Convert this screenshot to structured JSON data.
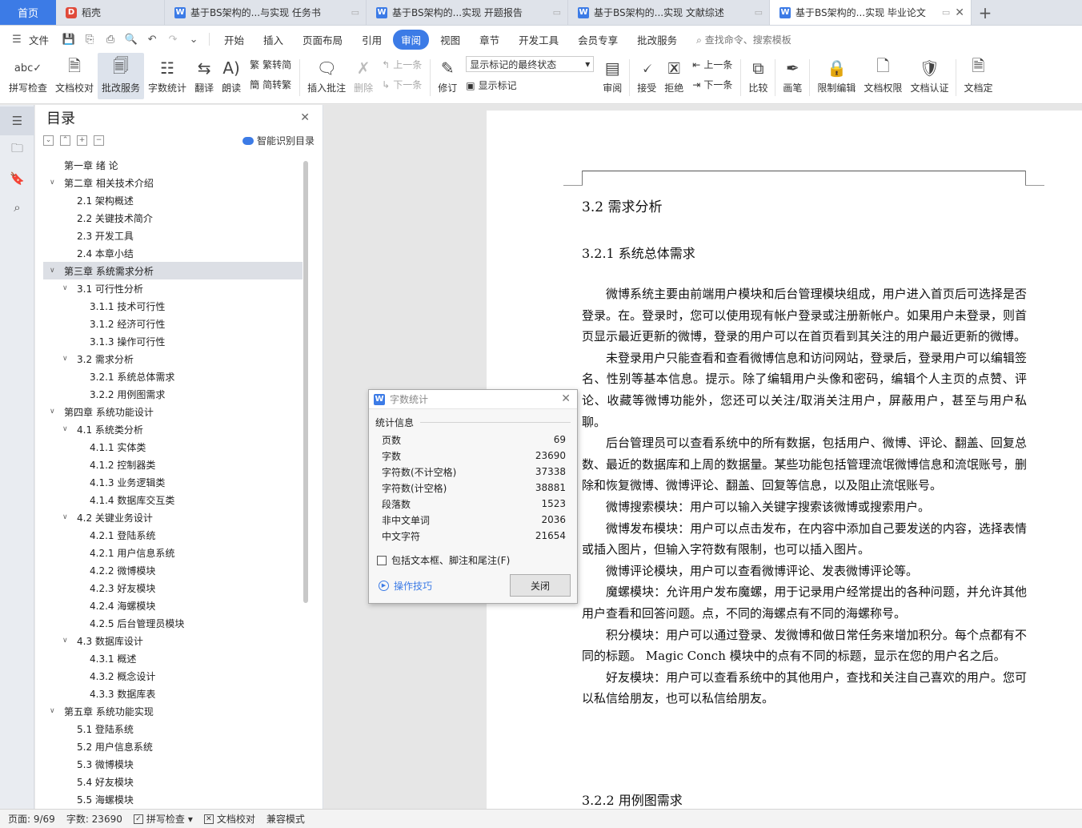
{
  "tabs": {
    "home": "首页",
    "items": [
      {
        "label": "稻壳",
        "icon": "daoke-icon"
      },
      {
        "label": "基于BS架构的...与实现 任务书",
        "icon": "wps-writer-icon"
      },
      {
        "label": "基于BS架构的...实现 开题报告",
        "icon": "wps-writer-icon"
      },
      {
        "label": "基于BS架构的...实现 文献综述",
        "icon": "wps-writer-icon"
      },
      {
        "label": "基于BS架构的...实现 毕业论文",
        "icon": "wps-writer-icon"
      }
    ],
    "add": "+"
  },
  "menubar": {
    "file": "文件",
    "items": [
      "开始",
      "插入",
      "页面布局",
      "引用",
      "审阅",
      "视图",
      "章节",
      "开发工具",
      "会员专享",
      "批改服务"
    ],
    "active": "审阅",
    "search_placeholder": "查找命令、搜索模板"
  },
  "ribbon": {
    "spell_check": "拼写检查",
    "doc_proof": "文档校对",
    "correction_service": "批改服务",
    "word_count": "字数统计",
    "translate": "翻译",
    "read_aloud": "朗读",
    "to_traditional": "繁转简",
    "to_simplified": "简转繁",
    "insert_comment": "插入批注",
    "delete": "删除",
    "prev": "上一条",
    "next": "下一条",
    "track_changes": "修订",
    "markup_select": "显示标记的最终状态",
    "show_markup": "显示标记",
    "review": "审阅",
    "accept": "接受",
    "reject": "拒绝",
    "prev2": "上一条",
    "next2": "下一条",
    "compare": "比较",
    "pen": "画笔",
    "restrict_edit": "限制编辑",
    "doc_permission": "文档权限",
    "doc_cert": "文档认证",
    "doc_more": "文档定"
  },
  "toc": {
    "title": "目录",
    "smart": "智能识别目录",
    "items": [
      {
        "text": "第一章 绪  论",
        "level": 0,
        "arrow": ""
      },
      {
        "text": "第二章 相关技术介绍",
        "level": 0,
        "arrow": "v"
      },
      {
        "text": "2.1 架构概述",
        "level": 1,
        "arrow": ""
      },
      {
        "text": "2.2 关键技术简介",
        "level": 1,
        "arrow": ""
      },
      {
        "text": "2.3 开发工具",
        "level": 1,
        "arrow": ""
      },
      {
        "text": "2.4 本章小结",
        "level": 1,
        "arrow": ""
      },
      {
        "text": "第三章 系统需求分析",
        "level": 0,
        "arrow": "v",
        "selected": true
      },
      {
        "text": "3.1 可行性分析",
        "level": 1,
        "arrow": "v"
      },
      {
        "text": "3.1.1 技术可行性",
        "level": 2,
        "arrow": ""
      },
      {
        "text": "3.1.2 经济可行性",
        "level": 2,
        "arrow": ""
      },
      {
        "text": "3.1.3 操作可行性",
        "level": 2,
        "arrow": ""
      },
      {
        "text": "3.2 需求分析",
        "level": 1,
        "arrow": "v"
      },
      {
        "text": "3.2.1 系统总体需求",
        "level": 2,
        "arrow": ""
      },
      {
        "text": "3.2.2 用例图需求",
        "level": 2,
        "arrow": ""
      },
      {
        "text": "第四章 系统功能设计",
        "level": 0,
        "arrow": "v"
      },
      {
        "text": "4.1 系统类分析",
        "level": 1,
        "arrow": "v"
      },
      {
        "text": "4.1.1 实体类",
        "level": 2,
        "arrow": ""
      },
      {
        "text": "4.1.2 控制器类",
        "level": 2,
        "arrow": ""
      },
      {
        "text": "4.1.3 业务逻辑类",
        "level": 2,
        "arrow": ""
      },
      {
        "text": "4.1.4 数据库交互类",
        "level": 2,
        "arrow": ""
      },
      {
        "text": "4.2 关键业务设计",
        "level": 1,
        "arrow": "v"
      },
      {
        "text": "4.2.1 登陆系统",
        "level": 2,
        "arrow": ""
      },
      {
        "text": "4.2.1 用户信息系统",
        "level": 2,
        "arrow": ""
      },
      {
        "text": "4.2.2 微博模块",
        "level": 2,
        "arrow": ""
      },
      {
        "text": "4.2.3 好友模块",
        "level": 2,
        "arrow": ""
      },
      {
        "text": "4.2.4 海螺模块",
        "level": 2,
        "arrow": ""
      },
      {
        "text": "4.2.5 后台管理员模块",
        "level": 2,
        "arrow": ""
      },
      {
        "text": "4.3 数据库设计",
        "level": 1,
        "arrow": "v"
      },
      {
        "text": "4.3.1 概述",
        "level": 2,
        "arrow": ""
      },
      {
        "text": "4.3.2 概念设计",
        "level": 2,
        "arrow": ""
      },
      {
        "text": "4.3.3 数据库表",
        "level": 2,
        "arrow": ""
      },
      {
        "text": "第五章 系统功能实现",
        "level": 0,
        "arrow": "v"
      },
      {
        "text": "5.1 登陆系统",
        "level": 1,
        "arrow": ""
      },
      {
        "text": "5.2 用户信息系统",
        "level": 1,
        "arrow": ""
      },
      {
        "text": "5.3 微博模块",
        "level": 1,
        "arrow": ""
      },
      {
        "text": "5.4 好友模块",
        "level": 1,
        "arrow": ""
      },
      {
        "text": "5.5 海螺模块",
        "level": 1,
        "arrow": ""
      }
    ]
  },
  "document": {
    "h2": "3.2  需求分析",
    "h3": "3.2.1  系统总体需求",
    "paragraphs": [
      "微博系统主要由前端用户模块和后台管理模块组成，用户进入首页后可选择是否登录。在。登录时，您可以使用现有帐户登录或注册新帐户。如果用户未登录，则首页显示最近更新的微博，登录的用户可以在首页看到其关注的用户最近更新的微博。",
      "未登录用户只能查看和查看微博信息和访问网站，登录后，登录用户可以编辑签名、性别等基本信息。提示。除了编辑用户头像和密码，编辑个人主页的点赞、评论、收藏等微博功能外，您还可以关注/取消关注用户，屏蔽用户，甚至与用户私聊。",
      "后台管理员可以查看系统中的所有数据，包括用户、微博、评论、翻盖、回复总数、最近的数据库和上周的数据量。某些功能包括管理流氓微博信息和流氓账号，删除和恢复微博、微博评论、翻盖、回复等信息，以及阻止流氓账号。",
      "微博搜索模块：用户可以输入关键字搜索该微博或搜索用户。",
      "微博发布模块：用户可以点击发布，在内容中添加自己要发送的内容，选择表情或插入图片，但输入字符数有限制，也可以插入图片。",
      "微博评论模块，用户可以查看微博评论、发表微博评论等。",
      "魔螺模块：允许用户发布魔螺，用于记录用户经常提出的各种问题，并允许其他用户查看和回答问题。点，不同的海螺点有不同的海螺称号。",
      "积分模块：用户可以通过登录、发微博和做日常任务来增加积分。每个点都有不同的标题。 Magic Conch 模块中的点有不同的标题，显示在您的用户名之后。",
      "好友模块：用户可以查看系统中的其他用户，查找和关注自己喜欢的用户。您可以私信给朋友，也可以私信给朋友。"
    ],
    "h3b": "3.2.2  用例图需求"
  },
  "dialog": {
    "title": "字数统计",
    "group": "统计信息",
    "stats": [
      {
        "label": "页数",
        "value": "69"
      },
      {
        "label": "字数",
        "value": "23690"
      },
      {
        "label": "字符数(不计空格)",
        "value": "37338"
      },
      {
        "label": "字符数(计空格)",
        "value": "38881"
      },
      {
        "label": "段落数",
        "value": "1523"
      },
      {
        "label": "非中文单词",
        "value": "2036"
      },
      {
        "label": "中文字符",
        "value": "21654"
      }
    ],
    "include_label": "包括文本框、脚注和尾注(F)",
    "tips": "操作技巧",
    "close": "关闭"
  },
  "status": {
    "page": "页面: 9/69",
    "words": "字数: 23690",
    "spell": "拼写检查",
    "proof": "文档校对",
    "compat": "兼容模式"
  },
  "colors": {
    "accent": "#3c7be6",
    "active_tab": "#ffffff"
  }
}
